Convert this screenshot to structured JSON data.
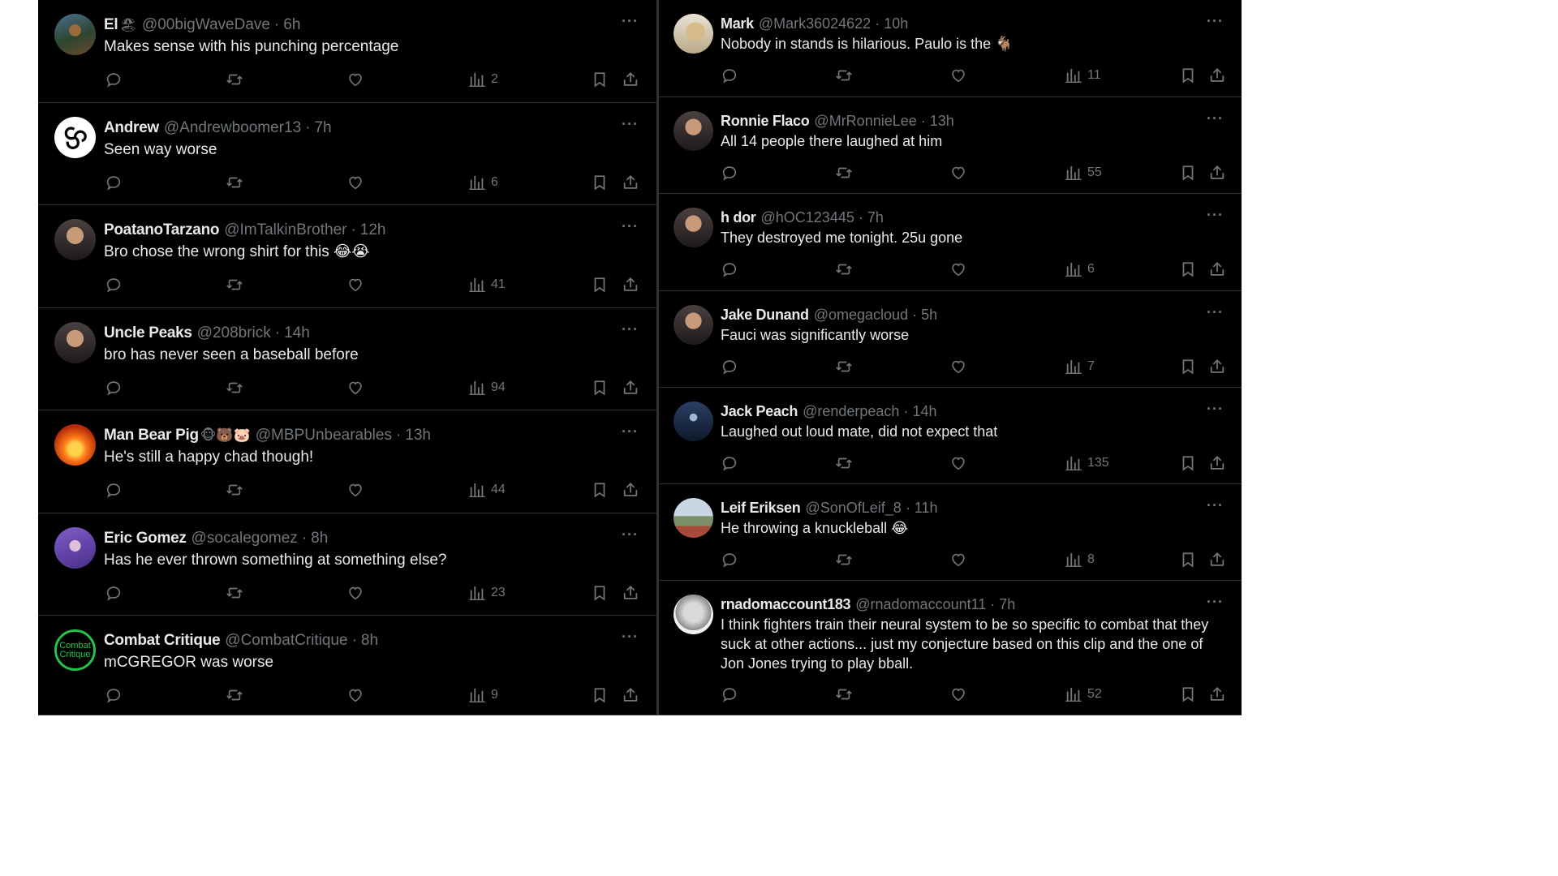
{
  "left_posts": [
    {
      "name": "El",
      "emoji": "🏖",
      "handle": "@00bigWaveDave",
      "time": "6h",
      "text": "Makes sense with his punching percentage",
      "views": "2",
      "avatar": "tree-photo-avatar"
    },
    {
      "name": "Andrew",
      "emoji": "",
      "handle": "@Andrewboomer13",
      "time": "7h",
      "text": "Seen way worse",
      "views": "6",
      "avatar": "triskelion-avatar"
    },
    {
      "name": "PoatanoTarzano",
      "emoji": "",
      "handle": "@ImTalkinBrother",
      "time": "12h",
      "text": "Bro chose the wrong shirt for this 😂😭",
      "views": "41",
      "avatar": "person-photo-avatar"
    },
    {
      "name": "Uncle Peaks",
      "emoji": "",
      "handle": "@208brick",
      "time": "14h",
      "text": "bro has never seen a baseball before",
      "views": "94",
      "avatar": "person-photo-avatar"
    },
    {
      "name": "Man Bear Pig",
      "emoji": "🐵🐻🐷",
      "handle": "@MBPUnbearables",
      "time": "13h",
      "text": "He's still a happy chad though!",
      "views": "44",
      "avatar": "fire-photo-avatar"
    },
    {
      "name": "Eric Gomez",
      "emoji": "",
      "handle": "@socalegomez",
      "time": "8h",
      "text": "Has he ever thrown something at something else?",
      "views": "23",
      "avatar": "purple-photo-avatar"
    },
    {
      "name": "Combat Critique",
      "emoji": "",
      "handle": "@CombatCritique",
      "time": "8h",
      "text": "mCGREGOR was worse",
      "views": "9",
      "avatar": "combat-critique-logo-avatar",
      "avatar_text": "Combat Critique"
    }
  ],
  "right_posts": [
    {
      "name": "Mark",
      "emoji": "",
      "handle": "@Mark36024622",
      "time": "10h",
      "text": "Nobody in stands is hilarious. Paulo is the 🐐",
      "views": "11",
      "avatar": "dog-photo-avatar"
    },
    {
      "name": "Ronnie Flaco",
      "emoji": "",
      "handle": "@MrRonnieLee",
      "time": "13h",
      "text": "All 14 people there laughed at him",
      "views": "55",
      "avatar": "person-photo-avatar"
    },
    {
      "name": "h dor",
      "emoji": "",
      "handle": "@hOC123445",
      "time": "7h",
      "text": "They destroyed me tonight. 25u gone",
      "views": "6",
      "avatar": "person-photo-avatar"
    },
    {
      "name": "Jake Dunand",
      "emoji": "",
      "handle": "@omegacloud",
      "time": "5h",
      "text": "Fauci was significantly worse",
      "views": "7",
      "avatar": "person-photo-avatar"
    },
    {
      "name": "Jack Peach",
      "emoji": "",
      "handle": "@renderpeach",
      "time": "14h",
      "text": "Laughed out loud mate, did not expect that",
      "views": "135",
      "avatar": "night-photo-avatar"
    },
    {
      "name": "Leif Eriksen",
      "emoji": "",
      "handle": "@SonOfLeif_8",
      "time": "11h",
      "text": "He throwing a knuckleball 😂",
      "views": "8",
      "avatar": "landscape-photo-avatar"
    },
    {
      "name": "rnadomaccount183",
      "emoji": "",
      "handle": "@rnadomaccount11",
      "time": "7h",
      "text": "I think fighters train their neural system to be so specific to combat that they suck at other actions... just my conjecture based on this clip and the one of Jon Jones trying to play bball.",
      "views": "52",
      "avatar": "statue-photo-avatar"
    }
  ],
  "ui": {
    "more": "···",
    "separator": "·"
  },
  "colors": {
    "background": "#000000",
    "text": "#e7e9ea",
    "muted": "#71767b",
    "divider": "#2f3336"
  },
  "icons": [
    "reply-icon",
    "retweet-icon",
    "like-icon",
    "views-icon",
    "bookmark-icon",
    "share-icon",
    "more-icon"
  ]
}
